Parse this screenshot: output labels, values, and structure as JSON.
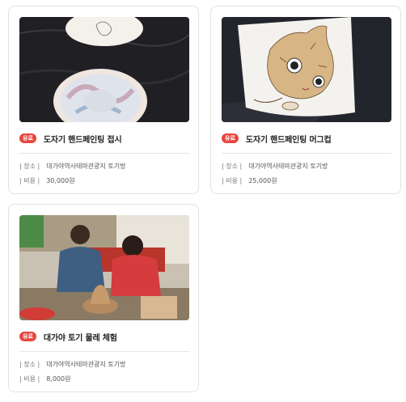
{
  "cards": [
    {
      "badge": "유료",
      "title": "도자기 핸드페인팅 접시",
      "place_label": "| 장소 |",
      "place_value": "대가야역사테마관광지 토기방",
      "cost_label": "| 비용 |",
      "cost_value": "30,000원",
      "image": "painted-ceramic-plates-photo"
    },
    {
      "badge": "유료",
      "title": "도자기 핸드페인팅 머그컵",
      "place_label": "| 장소 |",
      "place_value": "대가야역사테마관광지 토기방",
      "cost_label": "| 비용 |",
      "cost_value": "25,000원",
      "image": "cat-painted-mug-photo"
    },
    {
      "badge": "유료",
      "title": "대가야 토기 물레 체험",
      "place_label": "| 장소 |",
      "place_value": "대가야역사테마관광지 토기방",
      "cost_label": "| 비용 |",
      "cost_value": "8,000원",
      "image": "pottery-wheel-experience-photo"
    }
  ],
  "colors": {
    "badge": "#e8463f",
    "border": "#e3e3e3"
  }
}
